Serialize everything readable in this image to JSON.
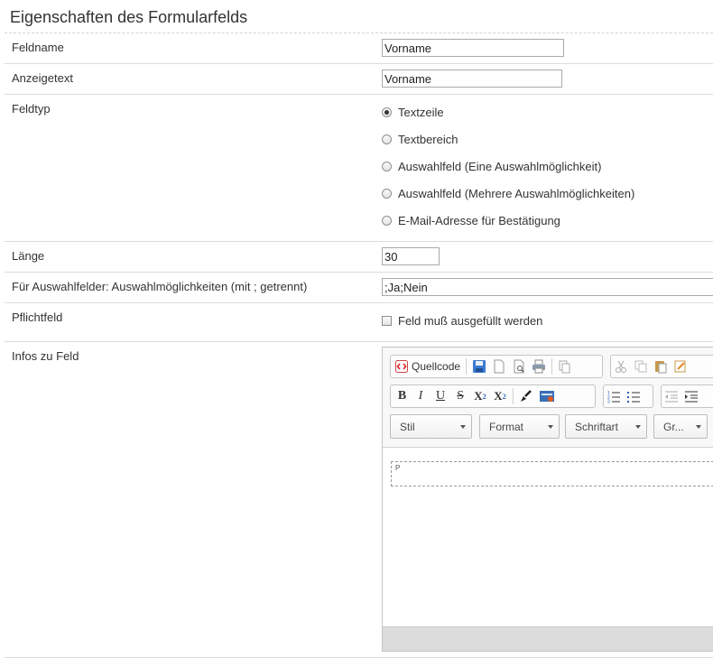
{
  "page": {
    "title": "Eigenschaften des Formularfelds"
  },
  "fields": {
    "feldname": {
      "label": "Feldname",
      "value": "Vorname"
    },
    "anzeigetext": {
      "label": "Anzeigetext",
      "value": "Vorname"
    },
    "feldtyp": {
      "label": "Feldtyp",
      "options": [
        {
          "label": "Textzeile",
          "selected": true
        },
        {
          "label": "Textbereich",
          "selected": false
        },
        {
          "label": "Auswahlfeld (Eine Auswahlmöglichkeit)",
          "selected": false
        },
        {
          "label": "Auswahlfeld (Mehrere Auswahlmöglichkeiten)",
          "selected": false
        },
        {
          "label": "E-Mail-Adresse für Bestätigung",
          "selected": false
        }
      ]
    },
    "laenge": {
      "label": "Länge",
      "value": "30"
    },
    "auswahl": {
      "label": "Für Auswahlfelder: Auswahlmöglichkeiten (mit ; getrennt)",
      "value": ";Ja;Nein"
    },
    "pflichtfeld": {
      "label": "Pflichtfeld",
      "checkbox_label": "Feld muß ausgefüllt werden",
      "checked": false
    },
    "infos": {
      "label": "Infos zu Feld"
    }
  },
  "editor": {
    "source_label": "Quellcode",
    "combos": {
      "stil": "Stil",
      "format": "Format",
      "schriftart": "Schriftart",
      "groesse": "Gr..."
    },
    "format_buttons": {
      "bold": "B",
      "italic": "I",
      "underline": "U",
      "strike": "S",
      "sub": "X",
      "sup": "X"
    },
    "content_tag": "P",
    "icons": [
      "source-icon",
      "save-icon",
      "new-page-icon",
      "preview-icon",
      "print-icon",
      "templates-icon",
      "cut-icon",
      "copy-icon",
      "paste-icon",
      "paste-word-icon",
      "remove-format-icon",
      "flash-icon",
      "numbered-list-icon",
      "bulleted-list-icon",
      "outdent-icon",
      "indent-icon"
    ]
  }
}
